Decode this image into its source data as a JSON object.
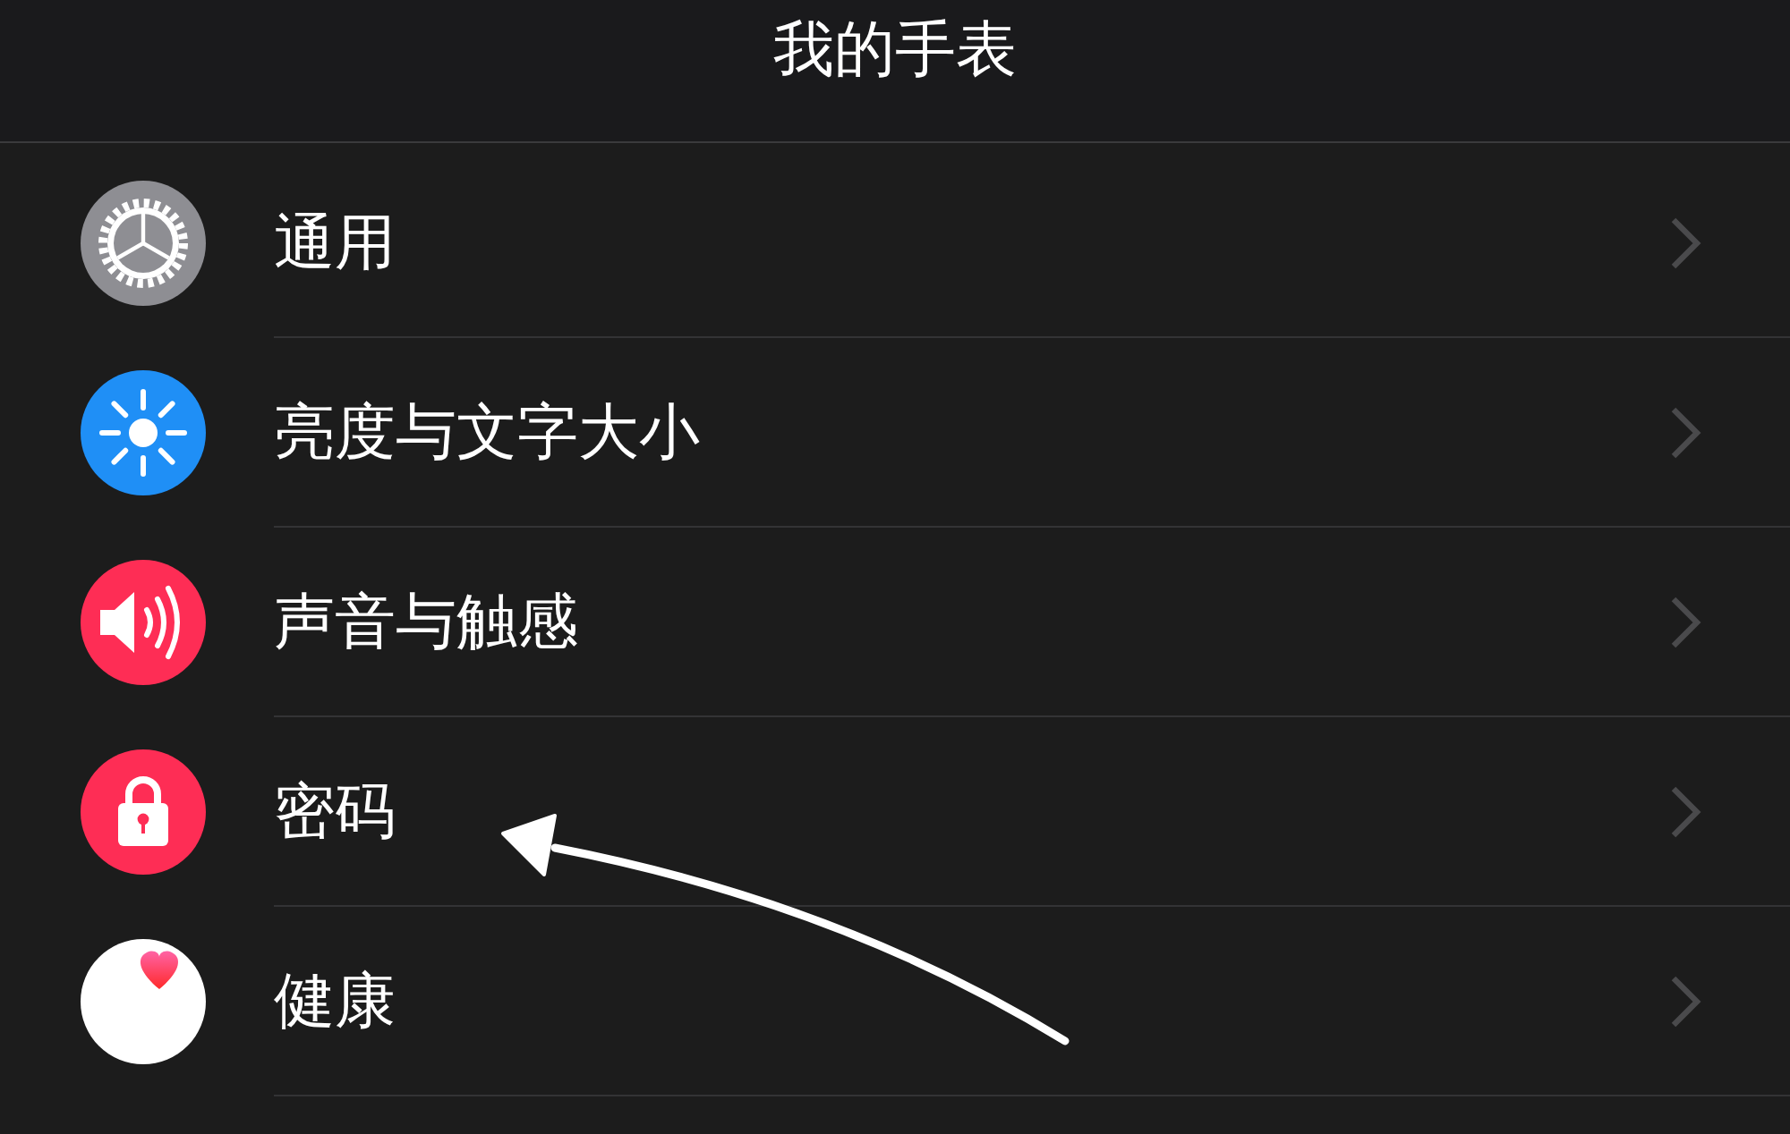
{
  "header": {
    "title": "我的手表"
  },
  "settings": [
    {
      "label": "通用",
      "kind": "gear",
      "color": "#8e8e93"
    },
    {
      "label": "亮度与文字大小",
      "kind": "sun",
      "color": "#1f8ff6"
    },
    {
      "label": "声音与触感",
      "kind": "speaker",
      "color": "#fe2d55"
    },
    {
      "label": "密码",
      "kind": "lock",
      "color": "#fe2d55"
    },
    {
      "label": "健康",
      "kind": "heart",
      "color": "#ffffff"
    }
  ]
}
